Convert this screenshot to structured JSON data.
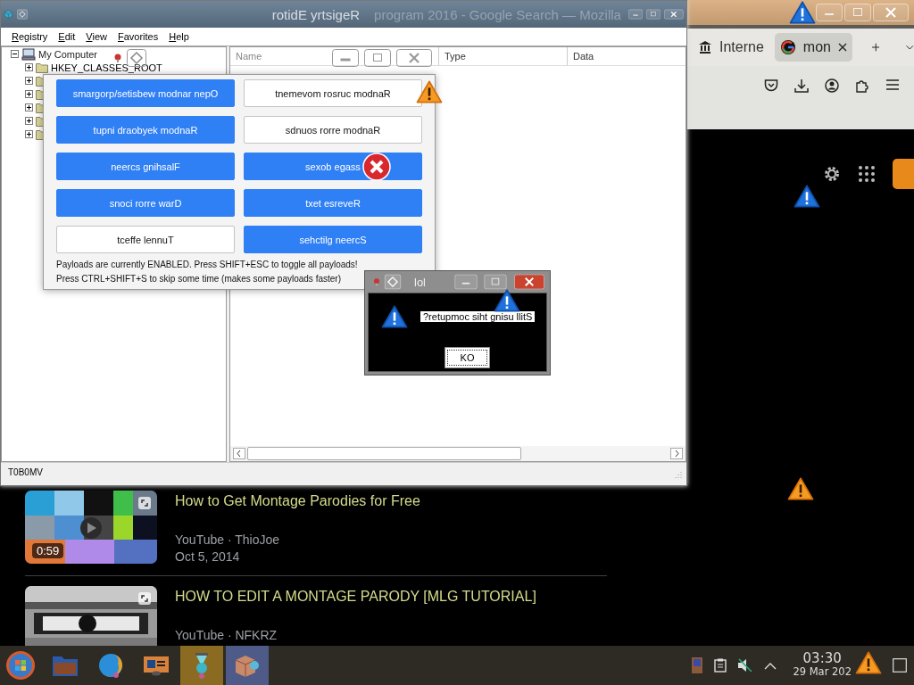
{
  "registry_editor": {
    "title": "rotidE yrtsigeR",
    "ghost_title": "program 2016 - Google Search — Mozilla",
    "menu": [
      "Registry",
      "Edit",
      "View",
      "Favorites",
      "Help"
    ],
    "tree": {
      "label": "My Computer",
      "expanded": true,
      "children": [
        {
          "label": "HKEY_CLASSES_ROOT",
          "expanded": false
        },
        {
          "expanded": false
        },
        {
          "expanded": false
        },
        {
          "expanded": false
        },
        {
          "expanded": false
        },
        {
          "expanded": false
        }
      ]
    },
    "columns": [
      "Name",
      "Type",
      "Data"
    ],
    "status_bar": "T0B0MV"
  },
  "payload_window": {
    "payloads": [
      {
        "label": "smargorp/setisbew modnar nepO",
        "on": true
      },
      {
        "label": "tnemevom rosruc modnaR",
        "on": false
      },
      {
        "label": "tupni draobyek modnaR",
        "on": true
      },
      {
        "label": "sdnuos rorre modnaR",
        "on": false
      },
      {
        "label": "neercs gnihsalF",
        "on": true
      },
      {
        "label": "sexob egass",
        "on": true
      },
      {
        "label": "snoci rorre warD",
        "on": true
      },
      {
        "label": "txet esreveR",
        "on": true
      },
      {
        "label": "tceffe lennuT",
        "on": false
      },
      {
        "label": "sehctilg neercS",
        "on": true
      }
    ],
    "status_lines": [
      "Payloads are currently ENABLED. Press SHIFT+ESC to toggle all payloads!",
      "Press CTRL+SHIFT+S to skip some time (makes some payloads faster)"
    ]
  },
  "message_box": {
    "title": "lol",
    "message": "?retupmoc siht gnisu llitS",
    "button": "KO"
  },
  "browser": {
    "tabs": [
      {
        "label": "Interne",
        "selected": false
      },
      {
        "label": "mon",
        "selected": true
      }
    ],
    "results": [
      {
        "title": "How to Get Montage Parodies for Free",
        "source": "YouTube · ThioJoe",
        "date": "Oct 5, 2014",
        "duration": "0:59"
      },
      {
        "title": "HOW TO EDIT A MONTAGE PARODY [MLG TUTORIAL]",
        "source": "YouTube · NFKRZ"
      }
    ]
  },
  "taskbar": {
    "apps": [
      {
        "kind": "folder",
        "selected": false,
        "attention": false
      },
      {
        "kind": "firefox",
        "selected": false,
        "attention": false
      },
      {
        "kind": "slides",
        "selected": false,
        "attention": false
      },
      {
        "kind": "hourglass",
        "selected": false,
        "attention": true
      },
      {
        "kind": "package",
        "selected": true,
        "attention": false
      }
    ],
    "clock": "03:30",
    "date": "29 Mar 202"
  }
}
